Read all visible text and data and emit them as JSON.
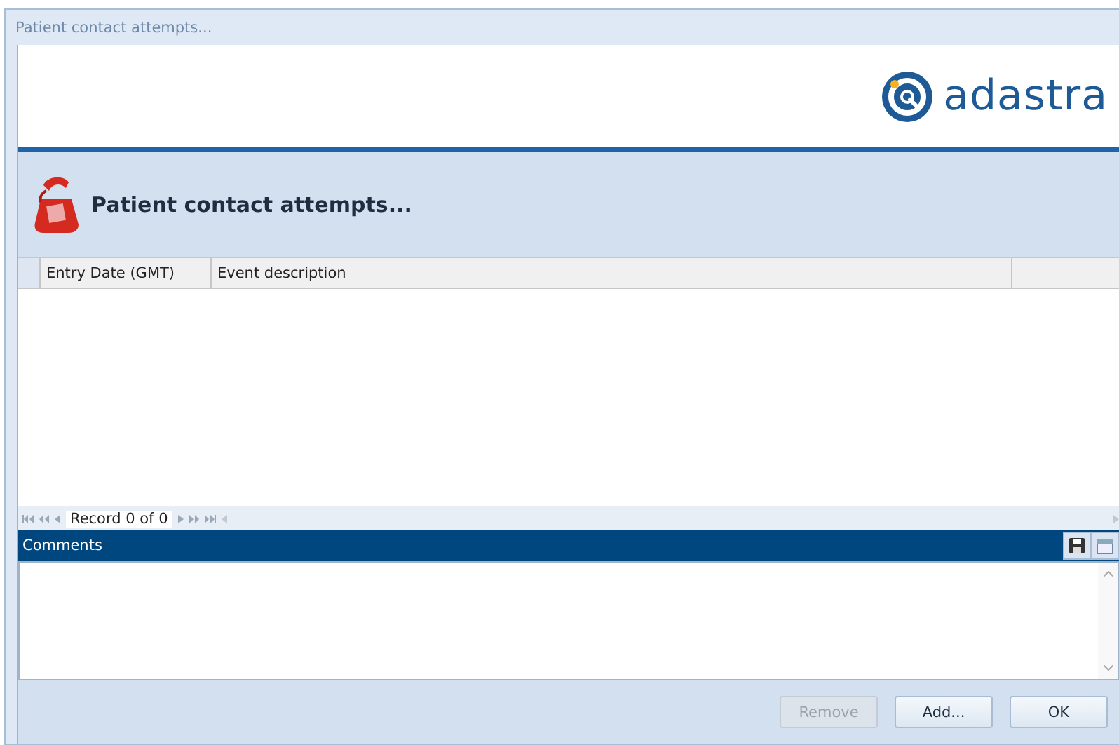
{
  "window": {
    "title": "Patient contact attempts..."
  },
  "logo": {
    "text": "adastra"
  },
  "header": {
    "title": "Patient contact attempts..."
  },
  "table": {
    "columns": [
      "Entry Date (GMT)",
      "Event description"
    ]
  },
  "navigator": {
    "record": "Record 0 of 0"
  },
  "comments": {
    "title": "Comments"
  },
  "buttons": [
    {
      "label": "Remove",
      "disabled": true
    },
    {
      "label": "Add...",
      "disabled": false
    },
    {
      "label": "OK",
      "disabled": false
    }
  ]
}
